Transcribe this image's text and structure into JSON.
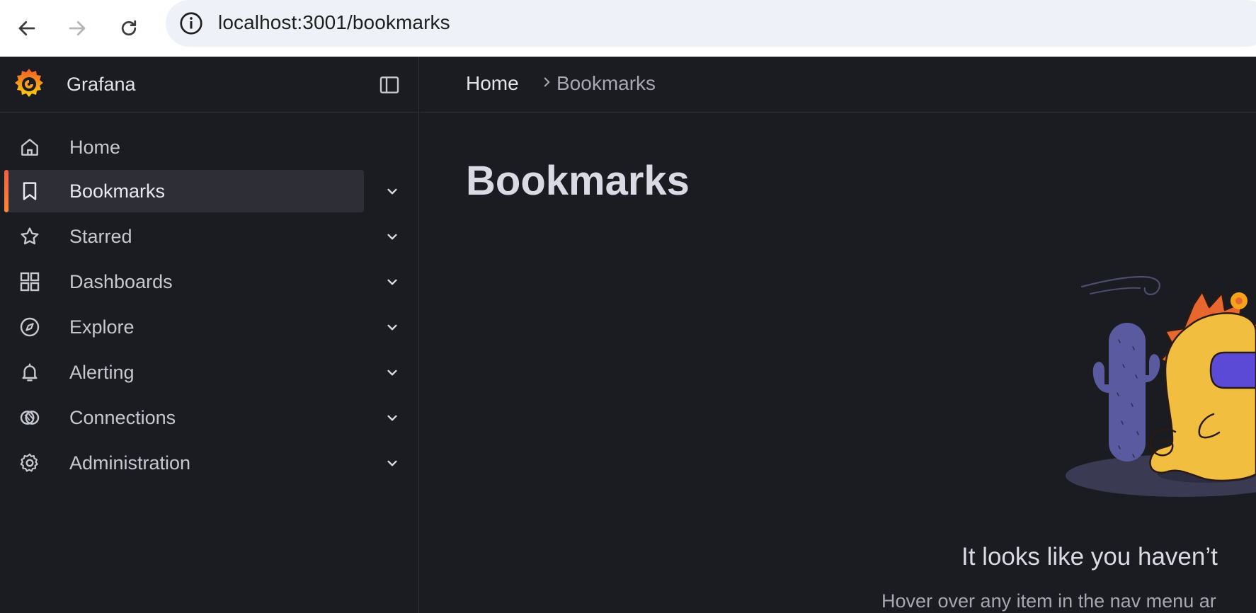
{
  "browser": {
    "url": "localhost:3001/bookmarks",
    "icons": [
      "back-arrow-icon",
      "forward-arrow-icon",
      "reload-icon",
      "info-icon"
    ]
  },
  "sidebar": {
    "brand": "Grafana",
    "items": [
      {
        "label": "Home",
        "icon": "home-icon",
        "active": false,
        "expandable": false
      },
      {
        "label": "Bookmarks",
        "icon": "bookmark-icon",
        "active": true,
        "expandable": true
      },
      {
        "label": "Starred",
        "icon": "star-icon",
        "active": false,
        "expandable": true
      },
      {
        "label": "Dashboards",
        "icon": "apps-icon",
        "active": false,
        "expandable": true
      },
      {
        "label": "Explore",
        "icon": "compass-icon",
        "active": false,
        "expandable": true
      },
      {
        "label": "Alerting",
        "icon": "bell-icon",
        "active": false,
        "expandable": true
      },
      {
        "label": "Connections",
        "icon": "connections-icon",
        "active": false,
        "expandable": true
      },
      {
        "label": "Administration",
        "icon": "gear-icon",
        "active": false,
        "expandable": true
      }
    ]
  },
  "breadcrumb": {
    "home": "Home",
    "current": "Bookmarks"
  },
  "main": {
    "title": "Bookmarks",
    "empty_title": "It looks like you haven’t",
    "empty_subtitle": "Hover over any item in the nav menu ar"
  },
  "colors": {
    "background": "#1b1c21",
    "accent": "#f55f3e",
    "active_item": "#2e2f36"
  }
}
